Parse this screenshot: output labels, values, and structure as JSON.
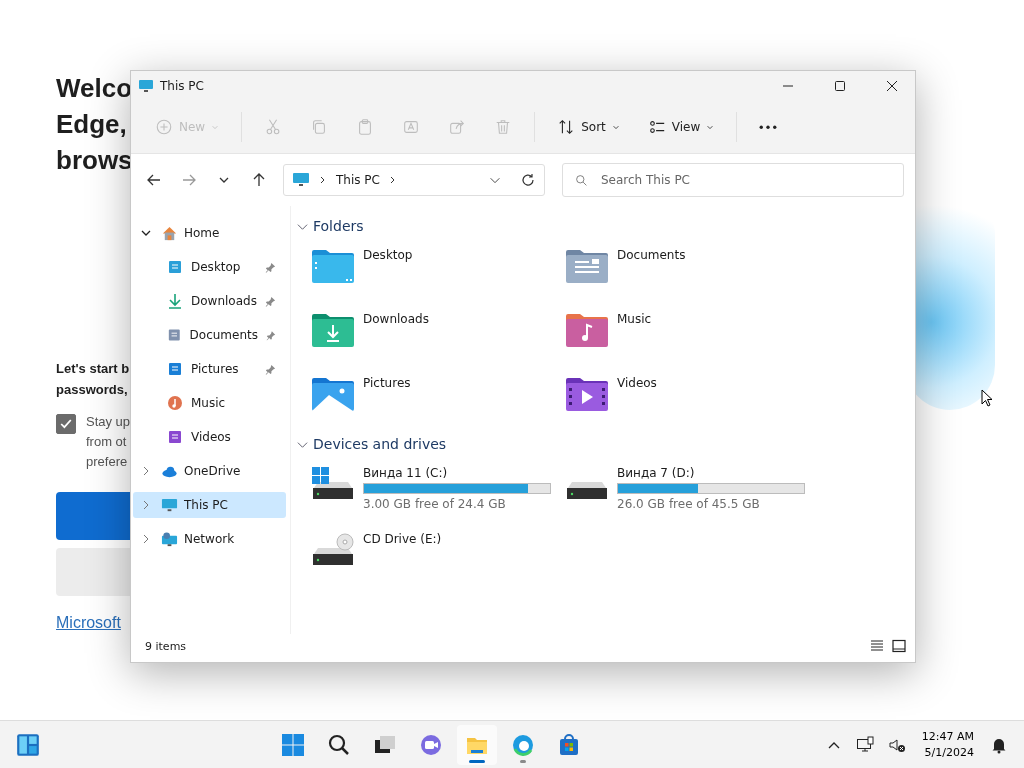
{
  "background_page": {
    "heading_lines": [
      "Welco",
      "Edge,",
      "brows"
    ],
    "intro_lines": [
      "Let's start b",
      "passwords,"
    ],
    "checkbox": {
      "checked": true,
      "lines": [
        "Stay up",
        "from ot",
        "prefere"
      ]
    },
    "link": "Microsoft"
  },
  "window": {
    "title": "This PC",
    "toolbar": [
      {
        "kind": "new",
        "label": "New",
        "disabled": true
      },
      {
        "kind": "cut",
        "disabled": true
      },
      {
        "kind": "copy",
        "disabled": true
      },
      {
        "kind": "paste",
        "disabled": true
      },
      {
        "kind": "rename",
        "disabled": true
      },
      {
        "kind": "share",
        "disabled": true
      },
      {
        "kind": "delete",
        "disabled": true
      },
      {
        "kind": "sort",
        "label": "Sort",
        "disabled": false
      },
      {
        "kind": "view",
        "label": "View",
        "disabled": false
      },
      {
        "kind": "more",
        "disabled": false
      }
    ],
    "address": {
      "path": [
        "This PC"
      ]
    },
    "search": {
      "placeholder": "Search This PC"
    },
    "sidebar": [
      {
        "kind": "home",
        "label": "Home",
        "expanded": true,
        "selected": false,
        "children": [
          {
            "kind": "desktop",
            "label": "Desktop",
            "pinned": true
          },
          {
            "kind": "downloads",
            "label": "Downloads",
            "pinned": true
          },
          {
            "kind": "documents",
            "label": "Documents",
            "pinned": true
          },
          {
            "kind": "pictures",
            "label": "Pictures",
            "pinned": true
          },
          {
            "kind": "music",
            "label": "Music",
            "pinned": false
          },
          {
            "kind": "videos",
            "label": "Videos",
            "pinned": false
          }
        ]
      },
      {
        "kind": "onedrive",
        "label": "OneDrive",
        "expanded": false,
        "selected": false
      },
      {
        "kind": "pc",
        "label": "This PC",
        "expanded": false,
        "selected": true
      },
      {
        "kind": "network",
        "label": "Network",
        "expanded": false,
        "selected": false
      }
    ],
    "sections": [
      {
        "title": "Folders",
        "expanded": true,
        "folders": [
          {
            "kind": "desktop",
            "name": "Desktop"
          },
          {
            "kind": "documents",
            "name": "Documents"
          },
          {
            "kind": "downloads",
            "name": "Downloads"
          },
          {
            "kind": "music",
            "name": "Music"
          },
          {
            "kind": "pictures",
            "name": "Pictures"
          },
          {
            "kind": "videos",
            "name": "Videos"
          }
        ]
      },
      {
        "title": "Devices and drives",
        "expanded": true,
        "drives": [
          {
            "kind": "system",
            "name": "Винда 11 (C:)",
            "level": 0.88,
            "free": "3.00 GB free of 24.4 GB"
          },
          {
            "kind": "disk",
            "name": "Винда 7 (D:)",
            "level": 0.43,
            "free": "26.0 GB free of 45.5 GB"
          },
          {
            "kind": "cd",
            "name": "CD Drive (E:)"
          }
        ]
      }
    ],
    "status_bar": {
      "count": "9 items"
    }
  },
  "taskbar": {
    "apps": [
      {
        "kind": "start",
        "running": false
      },
      {
        "kind": "search",
        "running": false
      },
      {
        "kind": "taskview",
        "running": false
      },
      {
        "kind": "chat",
        "running": false
      },
      {
        "kind": "explorer",
        "running": true,
        "selected": true
      },
      {
        "kind": "edge",
        "running": true,
        "selected": false
      },
      {
        "kind": "store",
        "running": false
      }
    ],
    "clock": {
      "time": "12:47 AM",
      "date": "5/1/2024"
    }
  }
}
